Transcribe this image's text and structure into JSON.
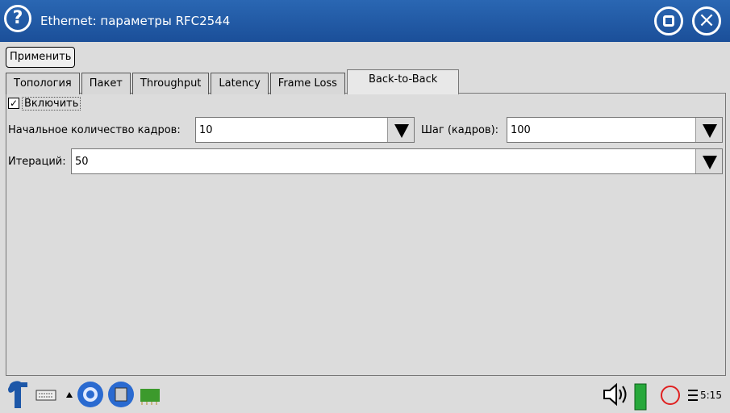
{
  "window": {
    "title": "Ethernet: параметры RFC2544",
    "help_icon": "?",
    "close_icon": "×"
  },
  "toolbar": {
    "apply_label": "Применить"
  },
  "tabs": [
    {
      "label": "Топология",
      "active": false
    },
    {
      "label": "Пакет",
      "active": false
    },
    {
      "label": "Throughput",
      "active": false
    },
    {
      "label": "Latency",
      "active": false
    },
    {
      "label": "Frame Loss",
      "active": false
    },
    {
      "label": "Back-to-Back",
      "active": true
    }
  ],
  "form": {
    "enable_checked": "✓",
    "enable_label": "Включить",
    "initial_frames_label": "Начальное количество кадров:",
    "initial_frames_value": "10",
    "step_label": "Шаг (кадров):",
    "step_value": "100",
    "iterations_label": "Итераций:",
    "iterations_value": "50"
  },
  "taskbar": {
    "icons": [
      "start-menu-icon",
      "keyboard-icon",
      "up-arrow-icon",
      "network-globe-icon",
      "file-manager-icon",
      "network-card-icon",
      "speaker-icon",
      "battery-icon",
      "record-icon",
      "status-icon"
    ],
    "clock": "5:15"
  }
}
